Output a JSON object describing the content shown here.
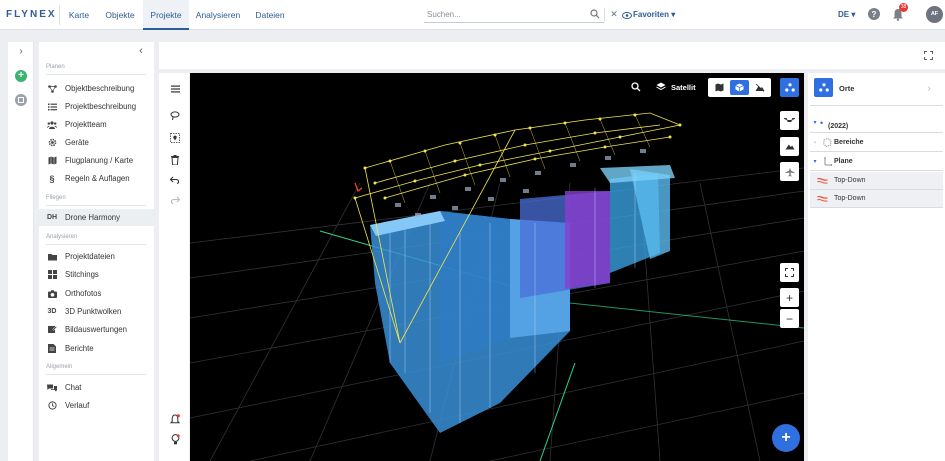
{
  "app": {
    "logo": "FLYNEX"
  },
  "nav": {
    "items": [
      {
        "label": "Karte"
      },
      {
        "label": "Objekte"
      },
      {
        "label": "Projekte",
        "active": true
      },
      {
        "label": "Analysieren"
      },
      {
        "label": "Dateien"
      }
    ]
  },
  "search": {
    "placeholder": "Suchen..."
  },
  "favorites": {
    "label": "Favoriten"
  },
  "language": {
    "label": "DE"
  },
  "notifications": {
    "count": "38"
  },
  "user": {
    "initials": "AF"
  },
  "sidebar": {
    "sections": {
      "planen": "Planen",
      "fliegen": "Fliegen",
      "analysieren": "Analysieren",
      "allgemein": "Allgemein"
    },
    "planen": [
      {
        "label": "Objektbeschreibung",
        "icon": "nodes-icon"
      },
      {
        "label": "Projektbeschreibung",
        "icon": "list-icon"
      },
      {
        "label": "Projektteam",
        "icon": "team-icon"
      },
      {
        "label": "Geräte",
        "icon": "gear-icon"
      },
      {
        "label": "Flugplanung / Karte",
        "icon": "map-icon"
      },
      {
        "label": "Regeln & Auflagen",
        "icon": "paragraph-icon"
      }
    ],
    "fliegen": [
      {
        "label": "Drone Harmony",
        "abbr": "DH"
      }
    ],
    "analysieren": [
      {
        "label": "Projektdateien",
        "icon": "folder-icon"
      },
      {
        "label": "Stitchings",
        "icon": "grid-icon"
      },
      {
        "label": "Orthofotos",
        "icon": "camera-icon"
      },
      {
        "label": "3D Punktwolken",
        "abbr": "3D"
      },
      {
        "label": "Bildauswertungen",
        "icon": "edit-image-icon"
      },
      {
        "label": "Berichte",
        "icon": "report-icon"
      }
    ],
    "allgemein": [
      {
        "label": "Chat",
        "icon": "chat-icon"
      },
      {
        "label": "Verlauf",
        "icon": "history-icon"
      }
    ]
  },
  "viewer": {
    "satellite_label": "Satellit"
  },
  "panel": {
    "title": "Orte",
    "items": [
      {
        "label": "(2022)",
        "dot": "•"
      },
      {
        "label": "Bereiche"
      },
      {
        "label": "Plane"
      },
      {
        "label": "Top-Down"
      },
      {
        "label": "Top-Down"
      }
    ]
  },
  "colors": {
    "accent": "#2f6fe0",
    "brand": "#2f5d97"
  }
}
